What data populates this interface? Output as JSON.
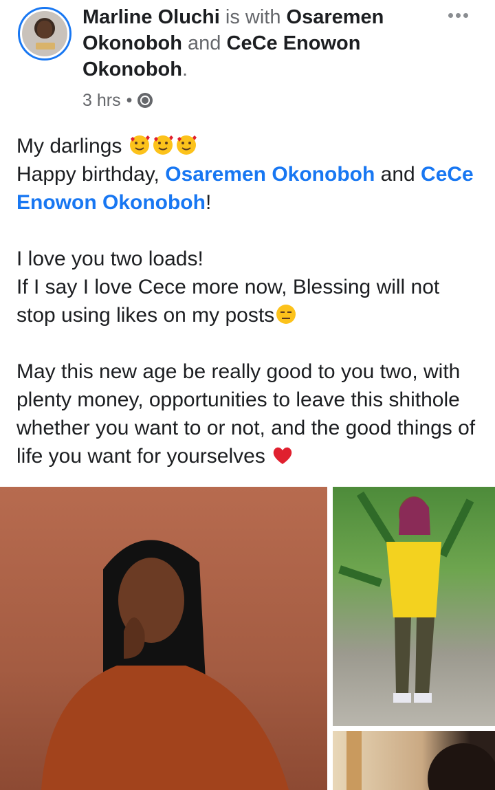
{
  "post": {
    "author": "Marline Oluchi",
    "with_word": "is with",
    "tagged_1": "Osaremen Okonoboh",
    "and_word": "and",
    "tagged_2": "CeCe Enowon Okonoboh",
    "period": ".",
    "time": "3 hrs",
    "dot": "•",
    "privacy_icon": "globe-icon",
    "more_icon": "more-options-icon"
  },
  "body": {
    "line1": "My darlings",
    "line2_prefix": "Happy birthday,",
    "mention_1": "Osaremen Okonoboh",
    "line2_and": "and",
    "mention_2": "CeCe Enowon Okonoboh",
    "line3_suffix": "!",
    "line4": "I love you two loads!",
    "line5": "If I say I love Cece more now, Blessing will not stop using likes on my posts",
    "line6": "May this new age be really good to you two, with plenty money, opportunities to leave this shithole whether you want to or not, and the good things of life you want for yourselves"
  },
  "photos": {
    "main": "photo-main",
    "side": "photo-side",
    "side2": "photo-side2"
  },
  "colors": {
    "link": "#1877f2",
    "muted": "#65676b",
    "text": "#1c1e21",
    "heart": "#e0202f"
  }
}
